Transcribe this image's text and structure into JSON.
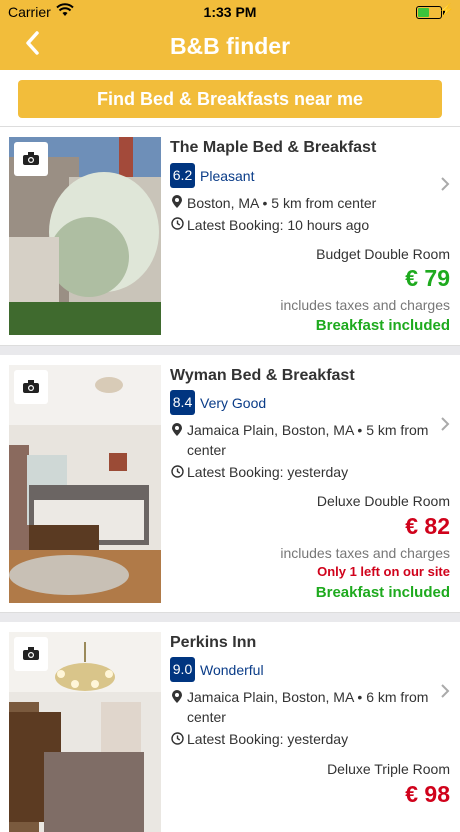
{
  "status_bar": {
    "carrier": "Carrier",
    "time": "1:33 PM"
  },
  "nav": {
    "back_icon": "chevron-left-icon",
    "title": "B&B finder"
  },
  "find_button": {
    "label": "Find Bed & Breakfasts near me"
  },
  "colors": {
    "accent": "#f2bd3b",
    "score_bg": "#003580",
    "price_green": "#1eaa1e",
    "price_red": "#d0021b"
  },
  "listings": [
    {
      "name": "The Maple Bed & Breakfast",
      "score": "6.2",
      "score_label": "Pleasant",
      "location": "Boston, MA • 5 km from center",
      "latest_booking": "Latest Booking: 10 hours ago",
      "room_type": "Budget Double Room",
      "price": "€ 79",
      "taxes": "includes taxes and charges",
      "breakfast": "Breakfast included"
    },
    {
      "name": "Wyman Bed & Breakfast",
      "score": "8.4",
      "score_label": "Very Good",
      "location": "Jamaica Plain, Boston, MA • 5 km from center",
      "latest_booking": "Latest Booking: yesterday",
      "room_type": "Deluxe Double Room",
      "price": "€ 82",
      "taxes": "includes taxes and charges",
      "availability": "Only 1 left on our site",
      "breakfast": "Breakfast included"
    },
    {
      "name": "Perkins Inn",
      "score": "9.0",
      "score_label": "Wonderful",
      "location": "Jamaica Plain, Boston, MA • 6 km from center",
      "latest_booking": "Latest Booking: yesterday",
      "room_type": "Deluxe Triple Room",
      "price": "€ 98"
    }
  ]
}
